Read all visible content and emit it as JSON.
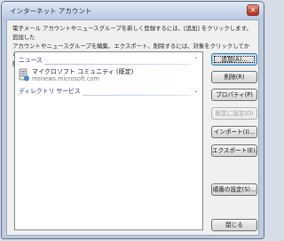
{
  "window": {
    "title": "インターネット アカウント",
    "close_glyph": "✕"
  },
  "description": "電子メール アカウントやニュースグループを新しく登録するには、[追加] をクリックします。追加した\nアカウントやニュースグループを編集、エクスポート、削除するには、対象をクリックしてから、希望の\n動作をクリックします。",
  "list": {
    "groups": [
      {
        "label": "ニュース",
        "chevron": "⌃",
        "items": [
          {
            "name": "マイクロソフト コミュニティ (既定)",
            "server": "msnews.microsoft.com",
            "icon": "newsgroup-server-icon"
          }
        ]
      },
      {
        "label": "ディレクトリ サービス",
        "chevron": "⌄",
        "items": []
      }
    ]
  },
  "buttons": {
    "add": "追加(A)...",
    "remove": "削除(R)",
    "properties": "プロパティ(P)",
    "set_default": "既定に設定(D)",
    "import": "インポート(I)...",
    "export": "エクスポート(E)...",
    "order": "順番の設定(S)...",
    "close": "閉じる"
  },
  "colors": {
    "title_bar": "#c6d6ea",
    "group_header_text": "#1e3287",
    "default_button_border": "#3c7fb1"
  }
}
